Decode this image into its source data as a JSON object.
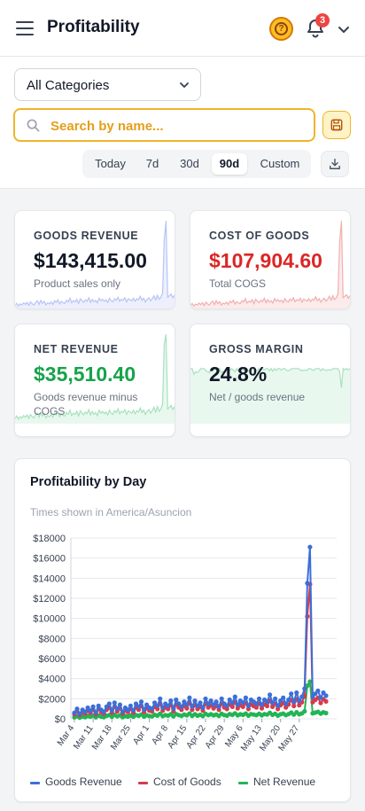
{
  "header": {
    "title": "Profitability",
    "notification_count": "3",
    "help_glyph": "?",
    "icons": [
      "menu-icon",
      "help-icon",
      "bell-icon",
      "chevron-down-icon"
    ]
  },
  "filters": {
    "category_selected": "All Categories",
    "search_placeholder": "Search by name...",
    "ranges": [
      "Today",
      "7d",
      "30d",
      "90d",
      "Custom"
    ],
    "active_range": "90d"
  },
  "cards": {
    "goods_revenue": {
      "label": "GOODS REVENUE",
      "value": "$143,415.00",
      "sub": "Product sales only",
      "color": "#6f86e8"
    },
    "cost_of_goods": {
      "label": "COST OF GOODS",
      "value": "$107,904.60",
      "sub": "Total COGS",
      "color": "#e35a5a",
      "value_color": "#dc2626"
    },
    "net_revenue": {
      "label": "NET REVENUE",
      "value": "$35,510.40",
      "sub": "Goods revenue minus COGS",
      "color": "#4cc27a",
      "value_color": "#16a34a"
    },
    "gross_margin": {
      "label": "GROSS MARGIN",
      "value": "24.8%",
      "sub": "Net / goods revenue",
      "color": "#4cc27a"
    }
  },
  "chart": {
    "title": "Profitability by Day",
    "timezone_note": "Times shown in America/Asuncion",
    "legend": [
      "Goods Revenue",
      "Cost of Goods",
      "Net Revenue"
    ]
  },
  "chart_data": {
    "type": "line",
    "x_tick_labels": [
      "Mar 4",
      "Mar 11",
      "Mar 18",
      "Mar 25",
      "Apr 1",
      "Apr 8",
      "Apr 15",
      "Apr 22",
      "Apr 29",
      "May 6",
      "May 13",
      "May 20",
      "May 27"
    ],
    "y_tick_labels": [
      "$0",
      "$2000",
      "$4000",
      "$6000",
      "$8000",
      "$10000",
      "$12000",
      "$14000",
      "$16000",
      "$18000"
    ],
    "ylim": [
      0,
      18000
    ],
    "grid": true,
    "legend_position": "bottom",
    "series": [
      {
        "name": "Goods Revenue",
        "color": "#3b6fd9",
        "values": [
          600,
          1000,
          500,
          900,
          700,
          1100,
          800,
          1200,
          600,
          1300,
          900,
          700,
          1200,
          1500,
          800,
          1600,
          1000,
          1400,
          700,
          1100,
          900,
          1300,
          800,
          1500,
          1200,
          1700,
          900,
          1400,
          1100,
          1000,
          1600,
          1300,
          2000,
          1100,
          1500,
          1300,
          1800,
          1000,
          1900,
          1500,
          1200,
          1700,
          1400,
          2100,
          1200,
          1800,
          1300,
          1600,
          1100,
          2000,
          1500,
          1800,
          1400,
          1700,
          1200,
          2000,
          1500,
          1300,
          1900,
          1600,
          2200,
          1400,
          1800,
          1600,
          2100,
          1300,
          1900,
          1700,
          1500,
          2000,
          1400,
          1900,
          1700,
          2400,
          1600,
          2000,
          1300,
          1800,
          2100,
          1500,
          1900,
          2500,
          1700,
          2600,
          1800,
          2200,
          3000,
          13500,
          17100,
          2200,
          2500,
          2800,
          2100,
          2600,
          2300
        ]
      },
      {
        "name": "Cost of Goods",
        "color": "#d63b4b",
        "values": [
          450,
          750,
          380,
          680,
          530,
          830,
          600,
          900,
          450,
          980,
          680,
          530,
          900,
          1130,
          600,
          1200,
          750,
          1050,
          530,
          830,
          680,
          980,
          600,
          1130,
          900,
          1280,
          680,
          1050,
          830,
          750,
          1200,
          980,
          1500,
          830,
          1130,
          980,
          1350,
          750,
          1430,
          1130,
          900,
          1280,
          1050,
          1580,
          900,
          1350,
          980,
          1200,
          830,
          1500,
          1130,
          1350,
          1050,
          1280,
          900,
          1500,
          1130,
          980,
          1430,
          1200,
          1650,
          1050,
          1350,
          1200,
          1580,
          980,
          1430,
          1280,
          1130,
          1500,
          1050,
          1430,
          1280,
          1800,
          1200,
          1500,
          980,
          1350,
          1580,
          1130,
          1430,
          1880,
          1280,
          1950,
          1350,
          1650,
          2250,
          10200,
          13400,
          1650,
          1880,
          2100,
          1580,
          1950,
          1730
        ]
      },
      {
        "name": "Net Revenue",
        "color": "#22b455",
        "values": [
          150,
          250,
          120,
          220,
          170,
          270,
          200,
          300,
          150,
          320,
          220,
          170,
          300,
          370,
          200,
          400,
          250,
          350,
          170,
          270,
          220,
          320,
          200,
          370,
          300,
          420,
          220,
          350,
          270,
          250,
          400,
          320,
          500,
          270,
          370,
          320,
          450,
          250,
          470,
          370,
          300,
          420,
          350,
          520,
          300,
          450,
          320,
          400,
          270,
          500,
          370,
          450,
          350,
          420,
          300,
          500,
          370,
          320,
          470,
          400,
          550,
          350,
          450,
          400,
          520,
          320,
          470,
          420,
          370,
          500,
          350,
          470,
          420,
          600,
          400,
          500,
          320,
          450,
          520,
          370,
          470,
          620,
          420,
          650,
          450,
          550,
          750,
          3300,
          3700,
          550,
          620,
          700,
          520,
          650,
          570
        ]
      }
    ]
  }
}
